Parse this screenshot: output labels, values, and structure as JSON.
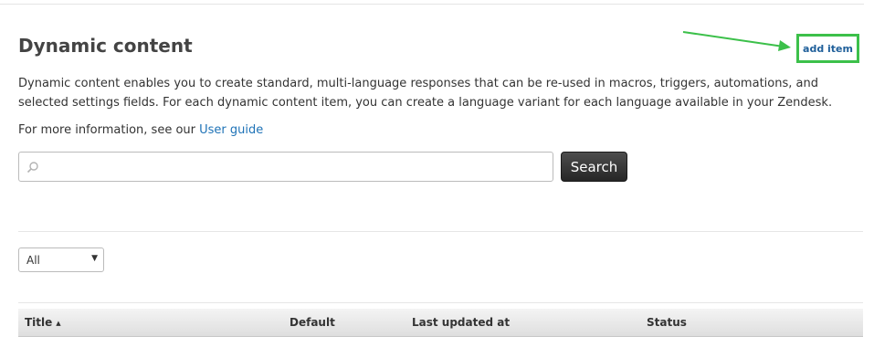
{
  "page": {
    "title": "Dynamic content",
    "add_item_label": "add item",
    "description": "Dynamic content enables you to create standard, multi-language responses that can be re-used in macros, triggers, automations, and selected settings fields. For each dynamic content item, you can create a language variant for each language available in your Zendesk.",
    "more_info_prefix": "For more information, see our ",
    "user_guide_link": "User guide"
  },
  "search": {
    "value": "",
    "placeholder": "",
    "button_label": "Search",
    "icon": "search-icon"
  },
  "filter": {
    "selected": "All"
  },
  "table": {
    "columns": [
      {
        "label": "Title",
        "sorted": "ascending"
      },
      {
        "label": "Default"
      },
      {
        "label": "Last updated at"
      },
      {
        "label": "Status"
      }
    ]
  },
  "colors": {
    "highlight_green": "#3cc04a",
    "link_blue": "#1f73b7",
    "button_dark": "#333333"
  }
}
